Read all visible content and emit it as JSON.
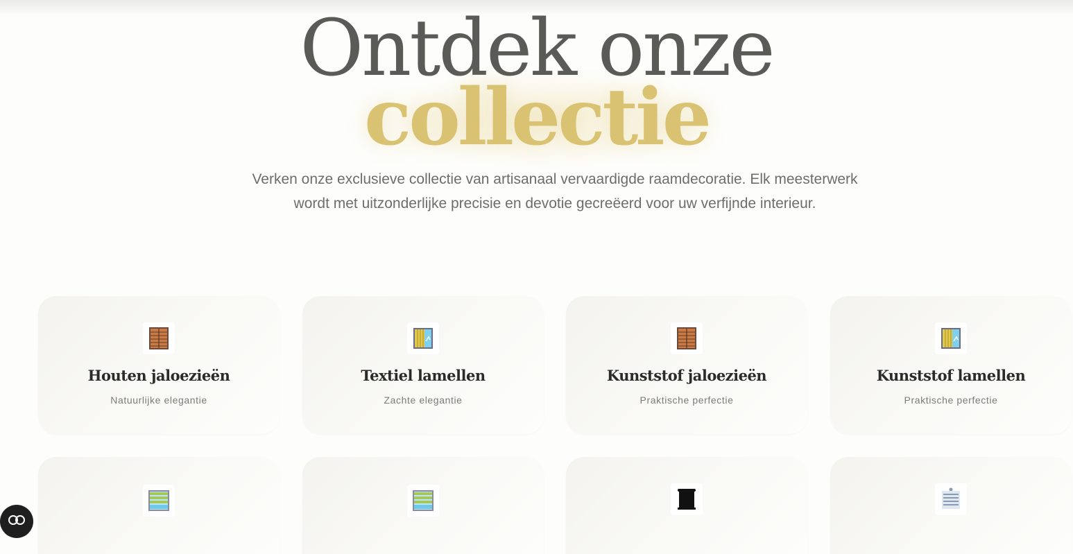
{
  "hero": {
    "title_line1": "Ontdek onze",
    "title_line2": "collectie",
    "subtitle": "Verken onze exclusieve collectie van artisanaal vervaardigde raamdecoratie. Elk meesterwerk wordt met uitzonderlijke precisie en devotie gecreëerd voor uw verfijnde interieur."
  },
  "colors": {
    "title_gray": "#5a5a57",
    "title_gold": "#d9c272",
    "card_bg": "#f4f3ee"
  },
  "products": [
    {
      "title": "Houten jaloezieën",
      "subtitle": "Natuurlijke elegantie",
      "icon": "wooden-blinds-icon"
    },
    {
      "title": "Textiel lamellen",
      "subtitle": "Zachte elegantie",
      "icon": "vertical-blinds-icon"
    },
    {
      "title": "Kunststof jaloezieën",
      "subtitle": "Praktische perfectie",
      "icon": "wooden-blinds-icon"
    },
    {
      "title": "Kunststof lamellen",
      "subtitle": "Praktische perfectie",
      "icon": "vertical-blinds-icon"
    },
    {
      "icon": "pleated-blinds-icon"
    },
    {
      "icon": "pleated-blinds-icon"
    },
    {
      "icon": "roller-blind-icon"
    },
    {
      "icon": "honeycomb-blinds-icon"
    }
  ],
  "fab": {
    "icon": "privacy-toggle-icon"
  }
}
